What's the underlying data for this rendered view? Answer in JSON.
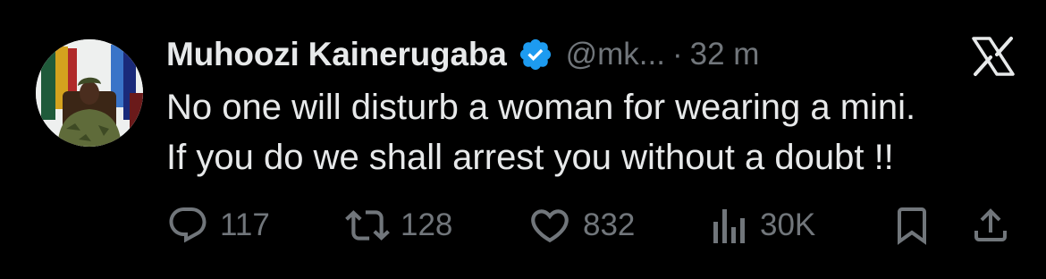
{
  "author": {
    "name": "Muhoozi Kainerugaba",
    "handle": "@mk...",
    "separator": "·",
    "time": "32 m",
    "verified": true
  },
  "tweet": {
    "lines": [
      "No one will disturb a woman for wearing a mini.",
      "If you do we shall arrest you without a doubt !!"
    ]
  },
  "actions": {
    "replies": "117",
    "retweets": "128",
    "likes": "832",
    "views": "30K"
  },
  "colors": {
    "background": "#000000",
    "text": "#e7e9ea",
    "secondary": "#71767b",
    "verified": "#1d9bf0"
  },
  "icons": {
    "platform": "x-logo-icon",
    "reply": "reply-icon",
    "retweet": "retweet-icon",
    "like": "heart-icon",
    "views": "views-icon",
    "bookmark": "bookmark-icon",
    "share": "share-icon"
  }
}
